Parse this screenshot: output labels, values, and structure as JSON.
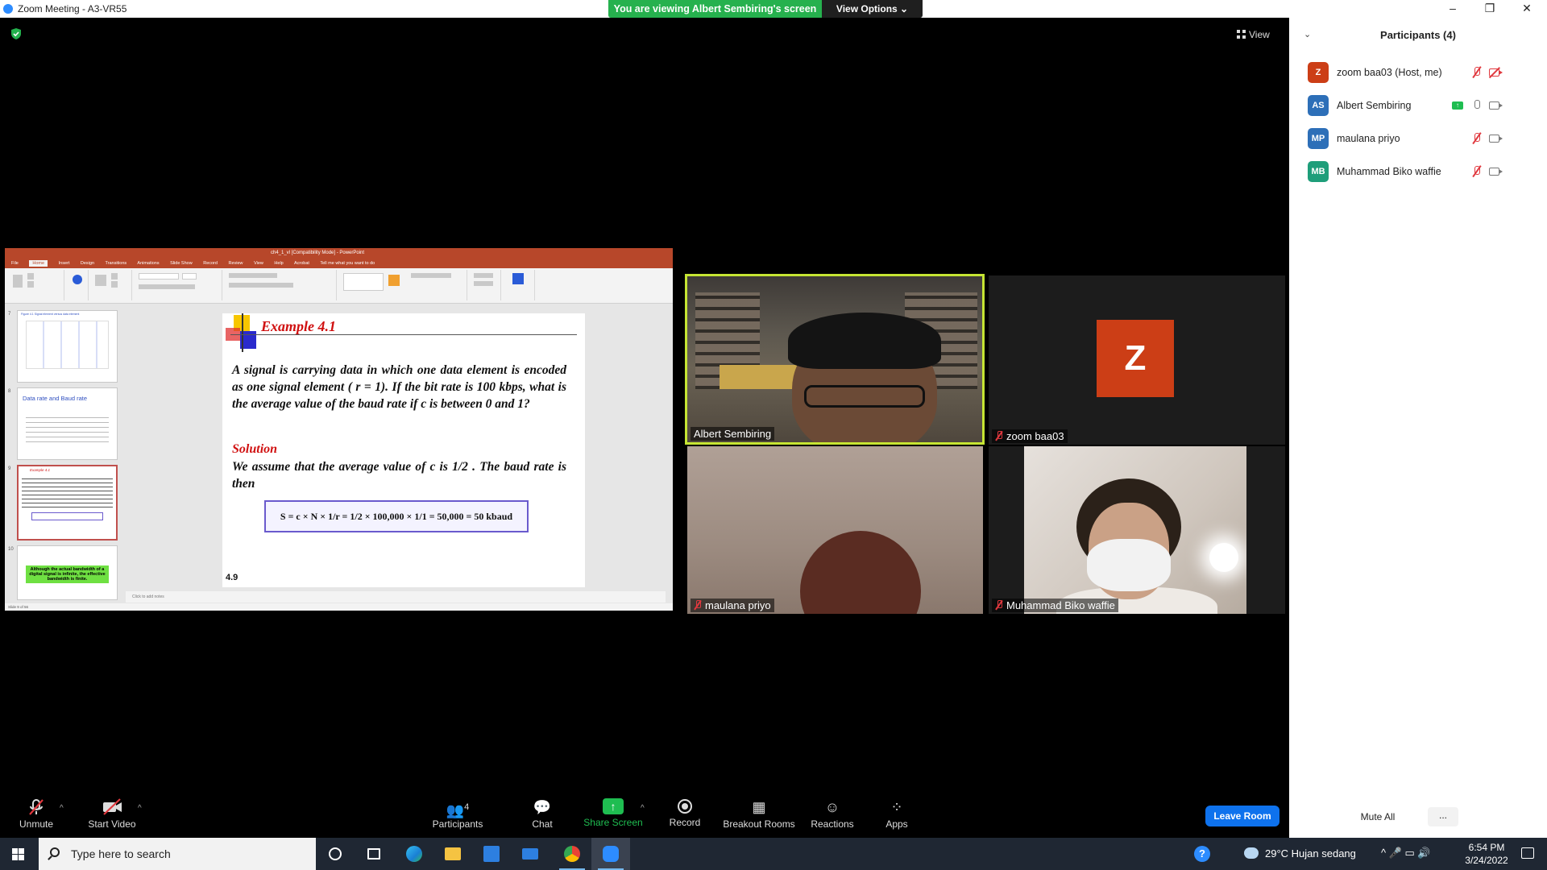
{
  "window": {
    "title": "Zoom Meeting - A3-VR55",
    "minimize": "–",
    "maximize": "❐",
    "close": "✕"
  },
  "banner": {
    "viewing_text": "You are viewing Albert Sembiring's screen",
    "view_options": "View Options ⌄"
  },
  "main": {
    "view_label": "View"
  },
  "shared_screen": {
    "ppt_title": "ch4_1_vl [Compatibility Mode] - PowerPoint",
    "tabs": [
      "File",
      "Home",
      "Insert",
      "Design",
      "Transitions",
      "Animations",
      "Slide Show",
      "Record",
      "Review",
      "View",
      "Help",
      "Acrobat",
      "Tell me what you want to do"
    ],
    "active_tab": "Home",
    "thumbnails": [
      {
        "num": "7",
        "title": "Figure 4.1 Signal element versus data element"
      },
      {
        "num": "8",
        "title": "Data rate and Baud rate"
      },
      {
        "num": "9",
        "title": "Example 4.1"
      },
      {
        "num": "10",
        "title": "Although the actual bandwidth of a digital signal is infinite, the effective bandwidth is finite."
      }
    ],
    "slide": {
      "title": "Example 4.1",
      "problem": "A signal is carrying data in which one data element is encoded as one signal element ( r = 1). If the bit rate is 100 kbps, what is the average value of the baud rate if c is between 0 and 1?",
      "solution_heading": "Solution",
      "solution_text": "We assume that the average value of c is 1/2 . The baud rate is then",
      "formula": "S = c × N × 1/r = 1/2 × 100,000 × 1/1 = 50,000 = 50 kbaud",
      "number": "4.9"
    },
    "notes_placeholder": "Click to add notes",
    "status": "Slide 9 of 56"
  },
  "videos": [
    {
      "name": "Albert Sembiring",
      "muted": false,
      "active_speaker": true
    },
    {
      "name": "zoom baa03",
      "muted": true,
      "avatar_letter": "Z",
      "avatar_color": "#cc3e16"
    },
    {
      "name": "maulana priyo",
      "muted": true
    },
    {
      "name": "Muhammad Biko waffie",
      "muted": true
    }
  ],
  "toolbar": {
    "unmute": "Unmute",
    "start_video": "Start Video",
    "participants": "Participants",
    "participants_count": "4",
    "chat": "Chat",
    "share_screen": "Share Screen",
    "record": "Record",
    "breakout_rooms": "Breakout Rooms",
    "reactions": "Reactions",
    "apps": "Apps",
    "leave_room": "Leave Room",
    "caret": "^"
  },
  "participants_panel": {
    "title": "Participants (4)",
    "collapse": "⌄",
    "list": [
      {
        "initials": "Z",
        "name": "zoom baa03 (Host, me)",
        "color": "#cc3e16",
        "mic": "muted",
        "cam": "off"
      },
      {
        "initials": "AS",
        "name": "Albert Sembiring",
        "color": "#2d6fb8",
        "mic": "on",
        "cam": "on",
        "sharing": true
      },
      {
        "initials": "MP",
        "name": "maulana priyo",
        "color": "#2d6fb8",
        "mic": "muted",
        "cam": "on"
      },
      {
        "initials": "MB",
        "name": "Muhammad Biko waffie",
        "color": "#1e9e7a",
        "mic": "muted",
        "cam": "on"
      }
    ],
    "mute_all": "Mute All",
    "more": "..."
  },
  "taskbar": {
    "search_placeholder": "Type here to search",
    "weather": "29°C  Hujan sedang",
    "time": "6:54 PM",
    "date": "3/24/2022",
    "system_icons": "^  🎤  ▭  🔊",
    "apps": [
      "task-view",
      "edge",
      "file-explorer",
      "store",
      "mail",
      "chrome",
      "zoom"
    ]
  },
  "colors": {
    "share_green": "#26b14e",
    "leave_blue": "#0e72ed",
    "active_speaker": "#c6e533",
    "mute_red": "#e0383e"
  }
}
